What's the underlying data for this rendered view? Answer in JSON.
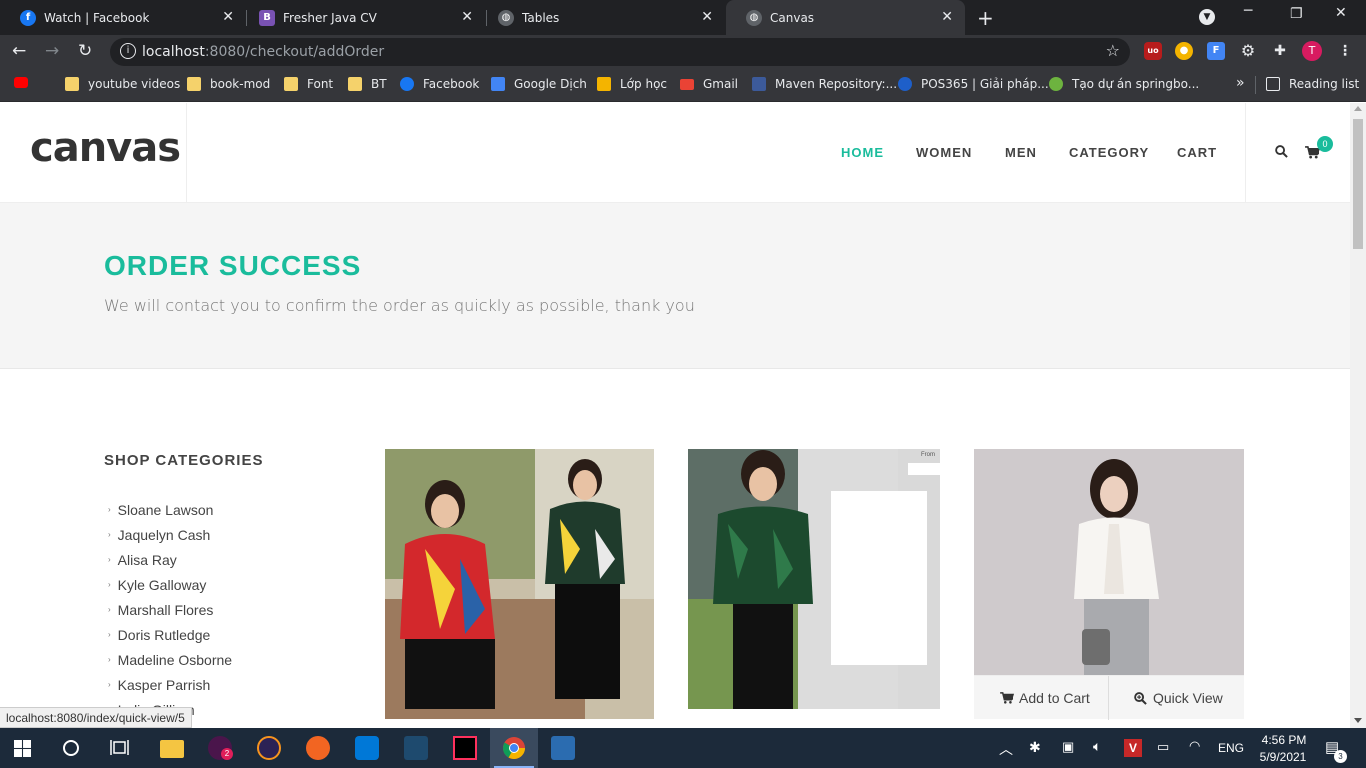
{
  "tabs": [
    {
      "title": "Watch | Facebook",
      "icon": "facebook-icon"
    },
    {
      "title": "Fresher Java CV",
      "icon": "bootstrap-icon"
    },
    {
      "title": "Tables",
      "icon": "globe-icon"
    },
    {
      "title": "Canvas",
      "icon": "globe-icon"
    }
  ],
  "address": {
    "host": "localhost",
    "rest": ":8080/checkout/addOrder"
  },
  "bookmarks": [
    {
      "label": "youtube videos"
    },
    {
      "label": "book-mod"
    },
    {
      "label": "Font"
    },
    {
      "label": "BT"
    },
    {
      "label": "Facebook"
    },
    {
      "label": "Google Dịch"
    },
    {
      "label": "Lớp học"
    },
    {
      "label": "Gmail"
    },
    {
      "label": "Maven Repository:..."
    },
    {
      "label": "POS365 | Giải pháp..."
    },
    {
      "label": "Tạo dự án springbo..."
    }
  ],
  "reading_list": "Reading list",
  "profile_initial": "T",
  "site": {
    "logo": "canvas",
    "menu": [
      "HOME",
      "WOMEN",
      "MEN",
      "CATEGORY",
      "CART"
    ],
    "cart_count": "0",
    "accent": "#1abc9c"
  },
  "hero": {
    "title": "ORDER SUCCESS",
    "subtitle": "We will contact you to confirm the order as quickly as possible, thank you"
  },
  "sidebar": {
    "title": "SHOP CATEGORIES",
    "items": [
      "Sloane Lawson",
      "Jaquelyn Cash",
      "Alisa Ray",
      "Kyle Galloway",
      "Marshall Flores",
      "Doris Rutledge",
      "Madeline Osborne",
      "Kasper Parrish",
      "Indie Gilliam"
    ]
  },
  "product_actions": {
    "add_to_cart": "Add to Cart",
    "quick_view": "Quick View"
  },
  "product_tag": "From",
  "status_url": "localhost:8080/index/quick-view/5",
  "taskbar": {
    "time": "4:56 PM",
    "date": "5/9/2021",
    "lang": "ENG",
    "notifications": "3",
    "badge": "2"
  }
}
